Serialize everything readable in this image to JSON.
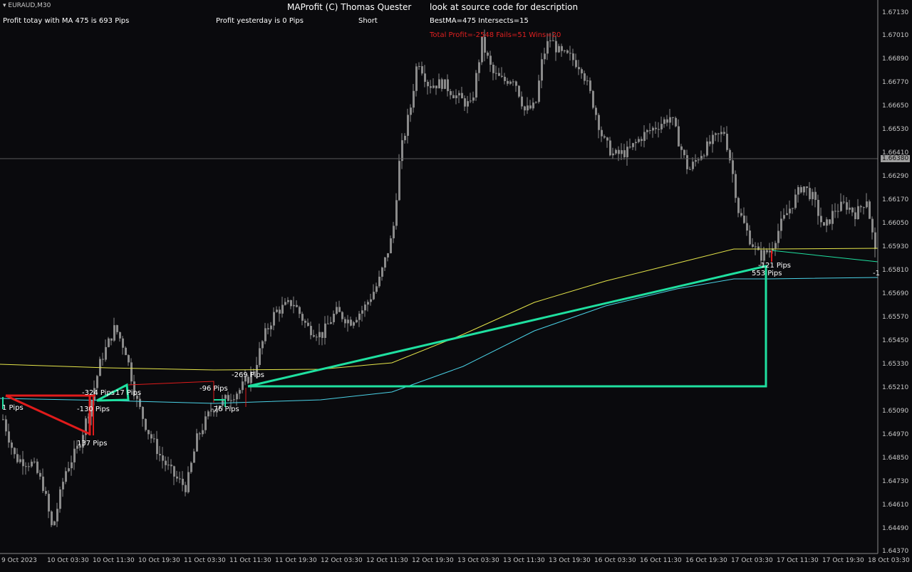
{
  "symbol": {
    "text": "EURAUD,M30",
    "icon": "triangle-down-icon"
  },
  "header": {
    "title": "MAProfit (C) Thomas Quester",
    "note": "look at source code for description",
    "profit_today": "Profit totay with MA 475 is 693 Pips",
    "profit_yesterday": "Profit yesterday is 0 Pips",
    "direction": "Short",
    "best_ma": "BestMA=475 Intersects=15",
    "total_profit": "Total Profit=-2548 Fails=51 Wins=20"
  },
  "colors": {
    "background": "#0a0a0d",
    "candles": "#8a8a8a",
    "ma_yellow": "#e6e64a",
    "ma_cyan": "#4ad2e6",
    "trade_win": "#1fe0a0",
    "trade_loss": "#e01b1b",
    "total_profit_text": "#e02020"
  },
  "price_axis": [
    "1.67130",
    "1.67010",
    "1.66890",
    "1.66770",
    "1.66650",
    "1.66530",
    "1.66410",
    "1.66290",
    "1.66170",
    "1.66050",
    "1.65930",
    "1.65810",
    "1.65690",
    "1.65570",
    "1.65450",
    "1.65330",
    "1.65210",
    "1.65090",
    "1.64970",
    "1.64850",
    "1.64730",
    "1.64610",
    "1.64490",
    "1.64370"
  ],
  "current_price": "1.66380",
  "time_axis": [
    "9 Oct 2023",
    "10 Oct 03:30",
    "10 Oct 11:30",
    "10 Oct 19:30",
    "11 Oct 03:30",
    "11 Oct 11:30",
    "11 Oct 19:30",
    "12 Oct 03:30",
    "12 Oct 11:30",
    "12 Oct 19:30",
    "13 Oct 03:30",
    "13 Oct 11:30",
    "13 Oct 19:30",
    "16 Oct 03:30",
    "16 Oct 11:30",
    "16 Oct 19:30",
    "17 Oct 03:30",
    "17 Oct 11:30",
    "17 Oct 19:30",
    "18 Oct 03:30"
  ],
  "trade_labels": [
    "1 Pips",
    "-324 Pips",
    "-130 Pips",
    "17 Pips",
    "137 Pips",
    "-96 Pips",
    "-269 Pips",
    "-76 Pips",
    "-121 Pips",
    "553 Pips",
    "-1"
  ]
}
